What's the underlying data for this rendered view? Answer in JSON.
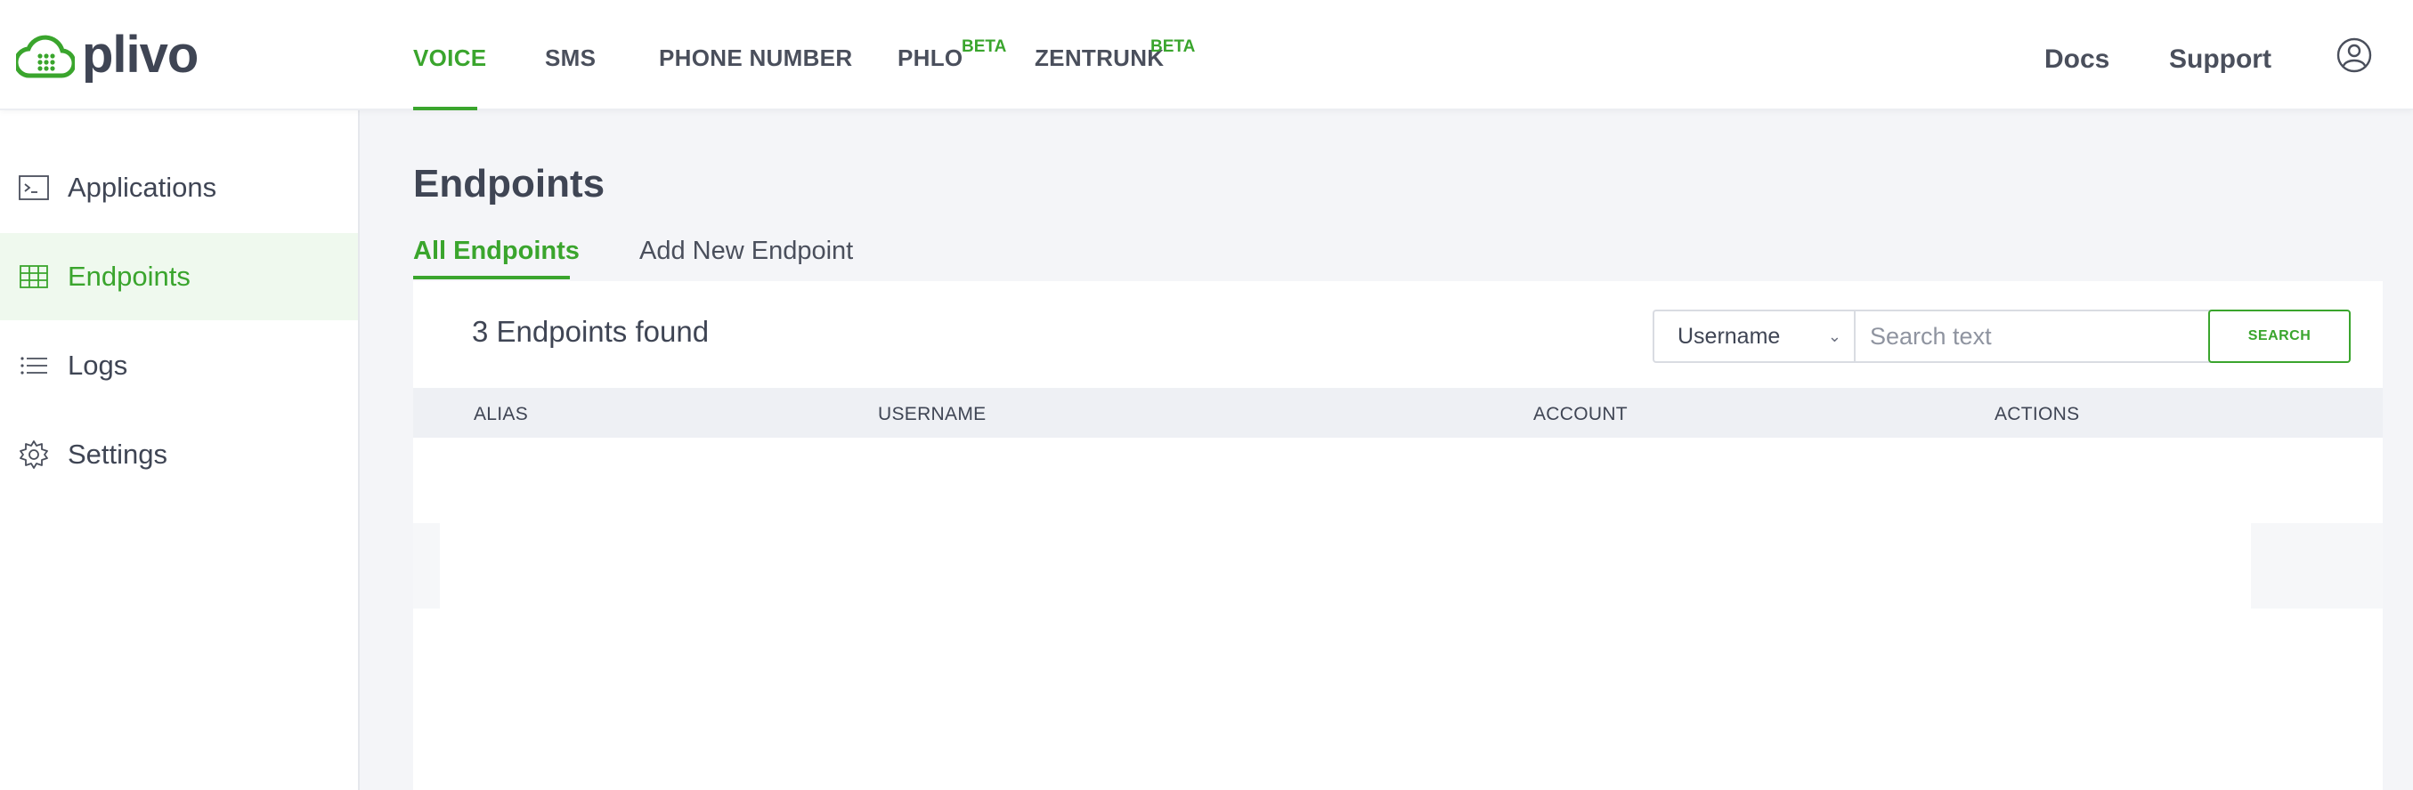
{
  "brand": {
    "name": "plivo",
    "accent": "#3aa52d"
  },
  "top_nav": {
    "items": [
      {
        "label": "VOICE",
        "active": true
      },
      {
        "label": "SMS"
      },
      {
        "label": "PHONE NUMBER"
      },
      {
        "label": "PHLO",
        "badge": "BETA"
      },
      {
        "label": "ZENTRUNK",
        "badge": "BETA"
      }
    ],
    "right": {
      "docs": "Docs",
      "support": "Support",
      "account_icon": "user-circle-icon"
    }
  },
  "sidebar": {
    "items": [
      {
        "label": "Applications",
        "icon": "terminal-icon"
      },
      {
        "label": "Endpoints",
        "icon": "grid-table-icon",
        "active": true
      },
      {
        "label": "Logs",
        "icon": "list-icon"
      },
      {
        "label": "Settings",
        "icon": "gear-icon"
      }
    ]
  },
  "main": {
    "title": "Endpoints",
    "tabs": [
      {
        "label": "All Endpoints",
        "active": true
      },
      {
        "label": "Add New Endpoint"
      }
    ],
    "results_text": "3 Endpoints found",
    "filter": {
      "selected": "Username",
      "search_placeholder": "Search text",
      "search_button": "SEARCH"
    },
    "table": {
      "columns": [
        "ALIAS",
        "USERNAME",
        "ACCOUNT",
        "ACTIONS"
      ]
    }
  }
}
